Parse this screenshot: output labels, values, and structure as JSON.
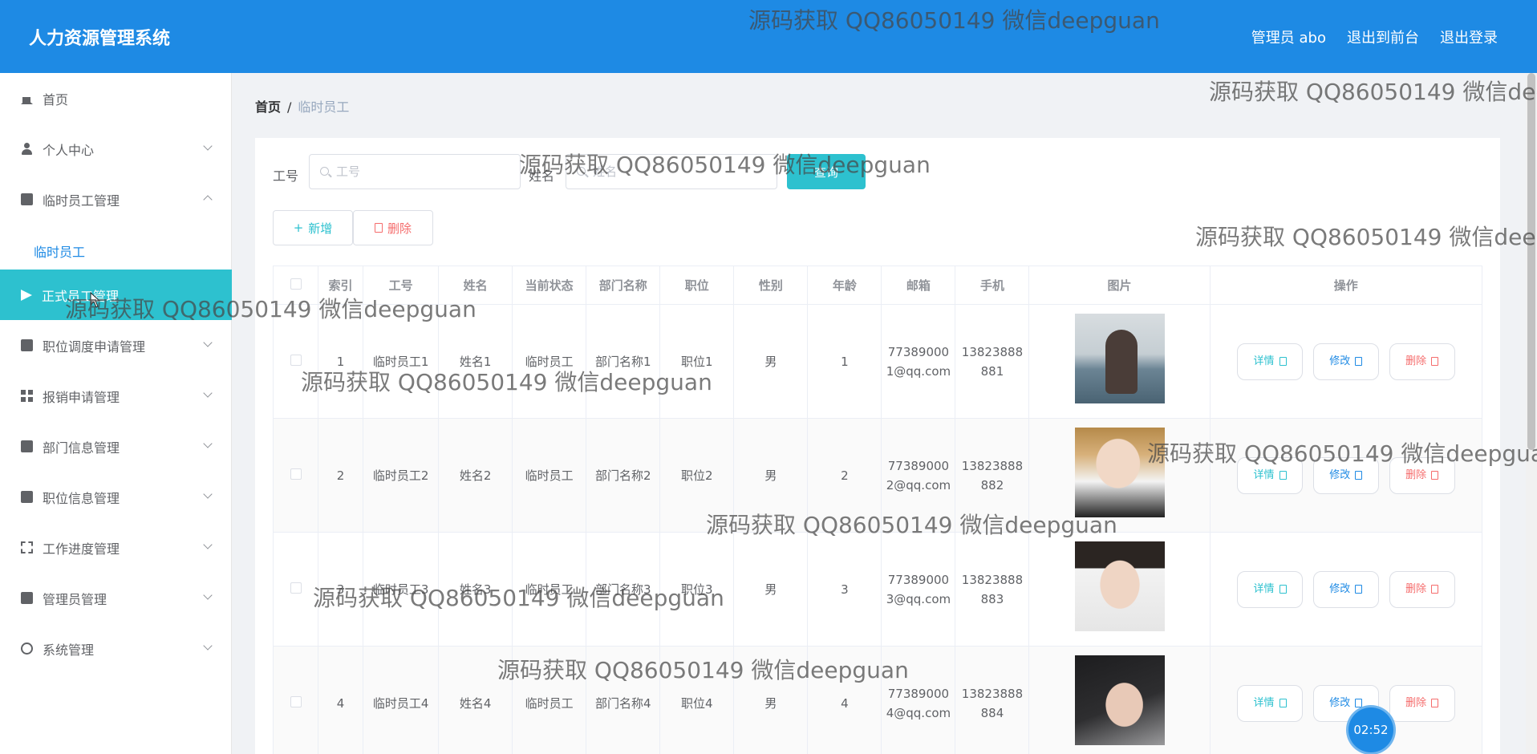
{
  "app": {
    "title": "人力资源管理系统"
  },
  "header": {
    "links": [
      "管理员 abo",
      "退出到前台",
      "退出登录"
    ]
  },
  "sidebar": {
    "items": [
      {
        "label": "首页",
        "icon": "home-icon"
      },
      {
        "label": "个人中心",
        "icon": "user-icon",
        "arrow": "down"
      },
      {
        "label": "临时员工管理",
        "icon": "clipboard-icon",
        "arrow": "up"
      },
      {
        "label": "正式员工管理",
        "icon": "paper-plane-icon",
        "active": true
      },
      {
        "label": "职位调度申请管理",
        "icon": "briefcase-icon",
        "arrow": "down"
      },
      {
        "label": "报销申请管理",
        "icon": "grid-icon",
        "arrow": "down"
      },
      {
        "label": "部门信息管理",
        "icon": "building-icon",
        "arrow": "down"
      },
      {
        "label": "职位信息管理",
        "icon": "ticket-icon",
        "arrow": "down"
      },
      {
        "label": "工作进度管理",
        "icon": "frame-icon",
        "arrow": "down"
      },
      {
        "label": "管理员管理",
        "icon": "clipboard-icon",
        "arrow": "down"
      },
      {
        "label": "系统管理",
        "icon": "gear-icon",
        "arrow": "down"
      }
    ],
    "submenu": {
      "label": "临时员工"
    }
  },
  "breadcrumb": {
    "home": "首页",
    "sep": "/",
    "current": "临时员工"
  },
  "search": {
    "job_label": "工号",
    "job_placeholder": "工号",
    "name_label": "姓名",
    "name_placeholder": "姓名",
    "query_button": "查询"
  },
  "actions": {
    "add": "新增",
    "delete": "删除"
  },
  "table": {
    "headers": [
      "索引",
      "工号",
      "姓名",
      "当前状态",
      "部门名称",
      "职位",
      "性别",
      "年龄",
      "邮箱",
      "手机",
      "图片",
      "操作"
    ],
    "rows": [
      {
        "index": "1",
        "job_no": "临时员工1",
        "name": "姓名1",
        "status": "临时员工",
        "dept": "部门名称1",
        "position": "职位1",
        "gender": "男",
        "age": "1",
        "email": "773890001@qq.com",
        "phone": "13823888881"
      },
      {
        "index": "2",
        "job_no": "临时员工2",
        "name": "姓名2",
        "status": "临时员工",
        "dept": "部门名称2",
        "position": "职位2",
        "gender": "男",
        "age": "2",
        "email": "773890002@qq.com",
        "phone": "13823888882"
      },
      {
        "index": "3",
        "job_no": "临时员工3",
        "name": "姓名3",
        "status": "临时员工",
        "dept": "部门名称3",
        "position": "职位3",
        "gender": "男",
        "age": "3",
        "email": "773890003@qq.com",
        "phone": "13823888883"
      },
      {
        "index": "4",
        "job_no": "临时员工4",
        "name": "姓名4",
        "status": "临时员工",
        "dept": "部门名称4",
        "position": "职位4",
        "gender": "男",
        "age": "4",
        "email": "773890004@qq.com",
        "phone": "13823888884"
      }
    ],
    "ops": {
      "detail": "详情",
      "edit": "修改",
      "delete": "删除"
    }
  },
  "timer": "02:52",
  "watermark": "源码获取 QQ86050149 微信deepguan",
  "colors": {
    "header": "#1e8ae4",
    "active_menu": "#2dc1cf",
    "primary": "#1e8ae4",
    "danger": "#f56c6c",
    "teal": "#2dc1cf"
  }
}
